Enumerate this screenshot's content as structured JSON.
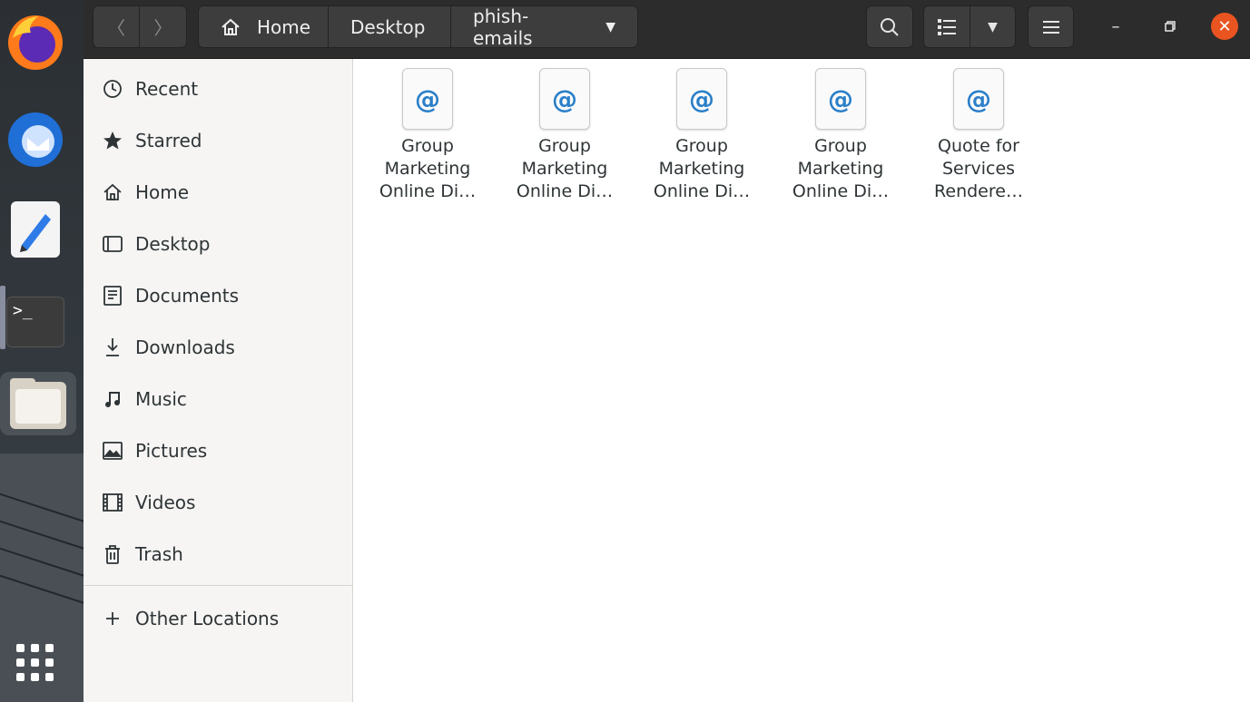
{
  "window": {
    "breadcrumb": [
      "Home",
      "Desktop",
      "phish-emails"
    ]
  },
  "dock": {
    "apps": [
      "firefox-icon",
      "thunderbird-icon",
      "text-editor-icon",
      "terminal-icon",
      "files-icon",
      "show-apps-icon"
    ],
    "terminal_glyph": ">_"
  },
  "sidebar": {
    "items": [
      {
        "label": "Recent",
        "icon": "clock-icon"
      },
      {
        "label": "Starred",
        "icon": "star-icon"
      },
      {
        "label": "Home",
        "icon": "home-icon"
      },
      {
        "label": "Desktop",
        "icon": "desktop-icon"
      },
      {
        "label": "Documents",
        "icon": "document-icon"
      },
      {
        "label": "Downloads",
        "icon": "download-icon"
      },
      {
        "label": "Music",
        "icon": "music-icon"
      },
      {
        "label": "Pictures",
        "icon": "picture-icon"
      },
      {
        "label": "Videos",
        "icon": "video-icon"
      },
      {
        "label": "Trash",
        "icon": "trash-icon"
      }
    ],
    "other_locations": "Other Locations"
  },
  "files": [
    {
      "line1": "Group",
      "line2": "Marketing",
      "line3": "Online Di…"
    },
    {
      "line1": "Group",
      "line2": "Marketing",
      "line3": "Online Di…"
    },
    {
      "line1": "Group",
      "line2": "Marketing",
      "line3": "Online Di…"
    },
    {
      "line1": "Group",
      "line2": "Marketing",
      "line3": "Online Di…"
    },
    {
      "line1": "Quote for",
      "line2": "Services",
      "line3": "Rendere…"
    }
  ],
  "file_icon_glyph": "@",
  "colors": {
    "accent": "#e95420",
    "headerbar": "#2c2c2c",
    "sidebar": "#f6f5f4",
    "email_glyph": "#2a7fc8"
  }
}
